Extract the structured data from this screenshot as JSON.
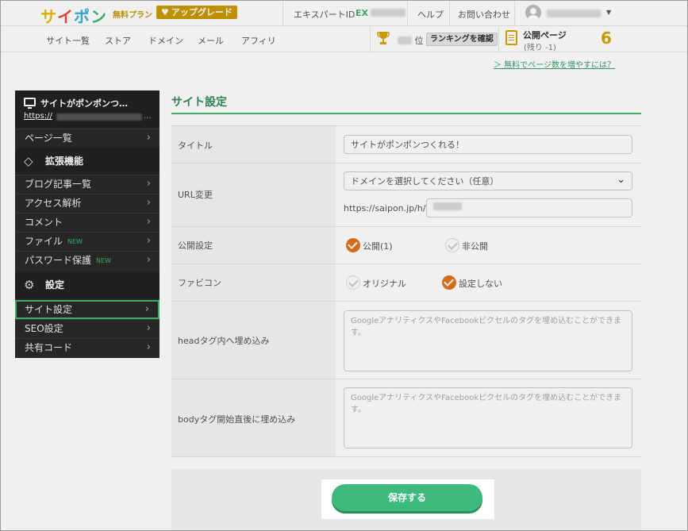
{
  "header": {
    "logo_chars": [
      "サ",
      "イ",
      "ポ",
      "ン"
    ],
    "plan": "無料プラン",
    "upgrade_label": "アップグレード",
    "expert_label": "エキスパートID",
    "expert_id_prefix": "EX",
    "help": "ヘルプ",
    "contact": "お問い合わせ"
  },
  "subnav": {
    "items": [
      "サイト一覧",
      "ストア",
      "ドメイン",
      "メール",
      "アフィリ"
    ],
    "rank_suffix": "位",
    "rank_button": "ランキングを確認",
    "pages_label": "公開ページ",
    "pages_remaining": "(残り -1)",
    "pages_count": "6",
    "more_pages_link": "＞ 無料でページ数を増やすには？"
  },
  "sidebar": {
    "site_name": "サイトがポンポンつ…",
    "site_url_prefix": "https://",
    "site_url_suffix": "...",
    "page_list": "ページ一覧",
    "section_extensions": "拡張機能",
    "items_ext": [
      {
        "label": "ブログ記事一覧",
        "new": ""
      },
      {
        "label": "アクセス解析",
        "new": ""
      },
      {
        "label": "コメント",
        "new": ""
      },
      {
        "label": "ファイル",
        "new": "NEW"
      },
      {
        "label": "パスワード保護",
        "new": "NEW"
      }
    ],
    "section_settings": "設定",
    "items_settings": [
      "サイト設定",
      "SEO設定",
      "共有コード"
    ]
  },
  "main": {
    "title": "サイト設定",
    "fields": {
      "title_label": "タイトル",
      "title_value": "サイトがポンポンつくれる！",
      "url_label": "URL変更",
      "domain_select": "ドメインを選択してください（任意）",
      "url_prefix": "https://saipon.jp/h/",
      "publish_label": "公開設定",
      "publish_on": "公開(1)",
      "publish_off": "非公開",
      "favicon_label": "ファビコン",
      "favicon_original": "オリジナル",
      "favicon_none": "設定しない",
      "head_label": "headタグ内へ埋め込み",
      "head_placeholder": "GoogleアナリティクスやFacebookピクセルのタグを埋め込むことができます。",
      "body_label": "bodyタグ開始直後に埋め込み",
      "body_placeholder": "GoogleアナリティクスやFacebookピクセルのタグを埋め込むことができます。"
    },
    "save_button": "保存する"
  },
  "colors": {
    "accent_green": "#3db86a",
    "check_orange": "#e2731c",
    "logo_yellow": "#d6a400"
  }
}
